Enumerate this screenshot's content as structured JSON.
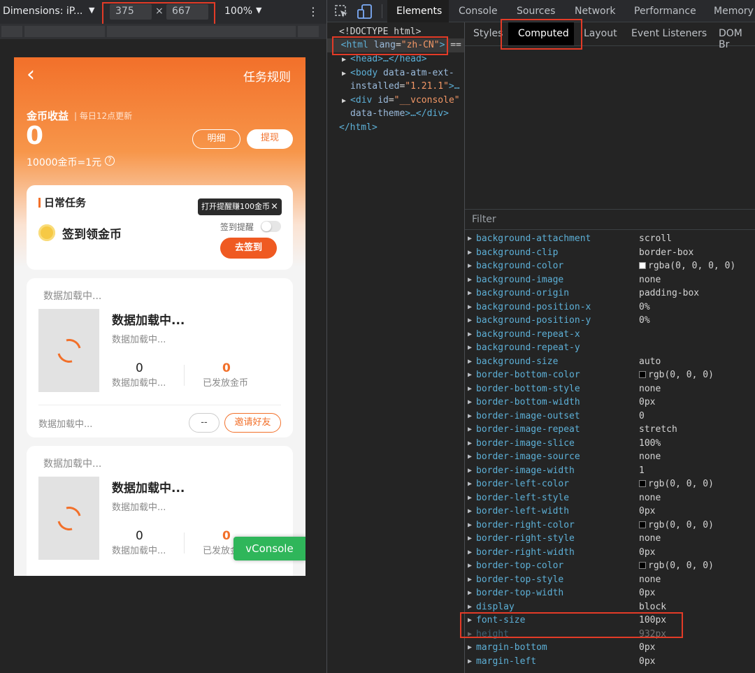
{
  "toolbar": {
    "device_label": "Dimensions: iP...",
    "width_value": "375",
    "times": "×",
    "height_value": "667",
    "zoom": "100%",
    "dropdown_glyph": "▼",
    "more_glyph": "⋮"
  },
  "devtools": {
    "tabs": [
      "Elements",
      "Console",
      "Sources",
      "Network",
      "Performance",
      "Memory"
    ],
    "active_tab": "Elements"
  },
  "dom": {
    "doctype": "<!DOCTYPE html>",
    "html_open_tag": "<html",
    "html_lang_attr": "lang",
    "html_lang_val": "\"zh-CN\"",
    "html_close_bracket": ">",
    "html_suffix": "==",
    "head": "<head>…</head>",
    "body_open": "<body",
    "body_attr": "data-atm-ext-",
    "body_attr2": "installed",
    "body_val": "\"1.21.1\"",
    "body_end": ">…",
    "div_open": "<div",
    "div_attr": "id",
    "div_val": "\"__vconsole\"",
    "div_attr2": "data-theme",
    "div_end": ">…</div>",
    "html_close": "</html>"
  },
  "subtabs": {
    "items": [
      "Styles",
      "Computed",
      "Layout",
      "Event Listeners",
      "DOM Br"
    ],
    "active": "Computed"
  },
  "filter": {
    "placeholder": "Filter"
  },
  "computed_props": [
    {
      "name": "background-attachment",
      "value": "scroll"
    },
    {
      "name": "background-clip",
      "value": "border-box"
    },
    {
      "name": "background-color",
      "value": "rgba(0, 0, 0, 0)",
      "swatch": "#ffffff"
    },
    {
      "name": "background-image",
      "value": "none"
    },
    {
      "name": "background-origin",
      "value": "padding-box"
    },
    {
      "name": "background-position-x",
      "value": "0%"
    },
    {
      "name": "background-position-y",
      "value": "0%"
    },
    {
      "name": "background-repeat-x",
      "value": ""
    },
    {
      "name": "background-repeat-y",
      "value": ""
    },
    {
      "name": "background-size",
      "value": "auto"
    },
    {
      "name": "border-bottom-color",
      "value": "rgb(0, 0, 0)",
      "swatch": "#000000"
    },
    {
      "name": "border-bottom-style",
      "value": "none"
    },
    {
      "name": "border-bottom-width",
      "value": "0px"
    },
    {
      "name": "border-image-outset",
      "value": "0"
    },
    {
      "name": "border-image-repeat",
      "value": "stretch"
    },
    {
      "name": "border-image-slice",
      "value": "100%"
    },
    {
      "name": "border-image-source",
      "value": "none"
    },
    {
      "name": "border-image-width",
      "value": "1"
    },
    {
      "name": "border-left-color",
      "value": "rgb(0, 0, 0)",
      "swatch": "#000000"
    },
    {
      "name": "border-left-style",
      "value": "none"
    },
    {
      "name": "border-left-width",
      "value": "0px"
    },
    {
      "name": "border-right-color",
      "value": "rgb(0, 0, 0)",
      "swatch": "#000000"
    },
    {
      "name": "border-right-style",
      "value": "none"
    },
    {
      "name": "border-right-width",
      "value": "0px"
    },
    {
      "name": "border-top-color",
      "value": "rgb(0, 0, 0)",
      "swatch": "#000000"
    },
    {
      "name": "border-top-style",
      "value": "none"
    },
    {
      "name": "border-top-width",
      "value": "0px"
    },
    {
      "name": "display",
      "value": "block"
    },
    {
      "name": "font-size",
      "value": "100px"
    },
    {
      "name": "height",
      "value": "932px",
      "dim": true
    },
    {
      "name": "margin-bottom",
      "value": "0px"
    },
    {
      "name": "margin-left",
      "value": "0px"
    }
  ],
  "phone": {
    "back_glyph": "‹",
    "rules_link": "任务规则",
    "coin_title": "金币收益",
    "update_note": "| 每日12点更新",
    "coin_amount": "0",
    "detail_btn": "明细",
    "withdraw_btn": "提现",
    "rate": "10000金币=1元",
    "help_glyph": "?",
    "daily_title": "日常任务",
    "tooltip": "打开提醒赚100金币",
    "tooltip_close": "×",
    "signin_title": "签到领金币",
    "reminder_label": "签到提醒",
    "signin_btn": "去签到",
    "loading_header": "数据加载中...",
    "loading_title": "数据加载中...",
    "loading_sub": "数据加载中...",
    "stat_left_value": "0",
    "stat_left_label": "数据加载中...",
    "stat_right_value": "0",
    "stat_right_label": "已发放金币",
    "footer_loading": "数据加载中...",
    "dash_btn": "--",
    "invite_btn": "邀请好友",
    "card2_header": "数据加载中...",
    "card2_title": "数据加载中...",
    "card2_sub": "数据加载中...",
    "card2_left_value": "0",
    "card2_left_label": "数据加载中...",
    "card2_right_value": "0",
    "card2_right_label": "已发放金币",
    "vconsole": "vConsole"
  },
  "colors": {
    "accent": "#f2702a",
    "highlight_box": "#e33b27",
    "vconsole_green": "#2fb65a"
  }
}
